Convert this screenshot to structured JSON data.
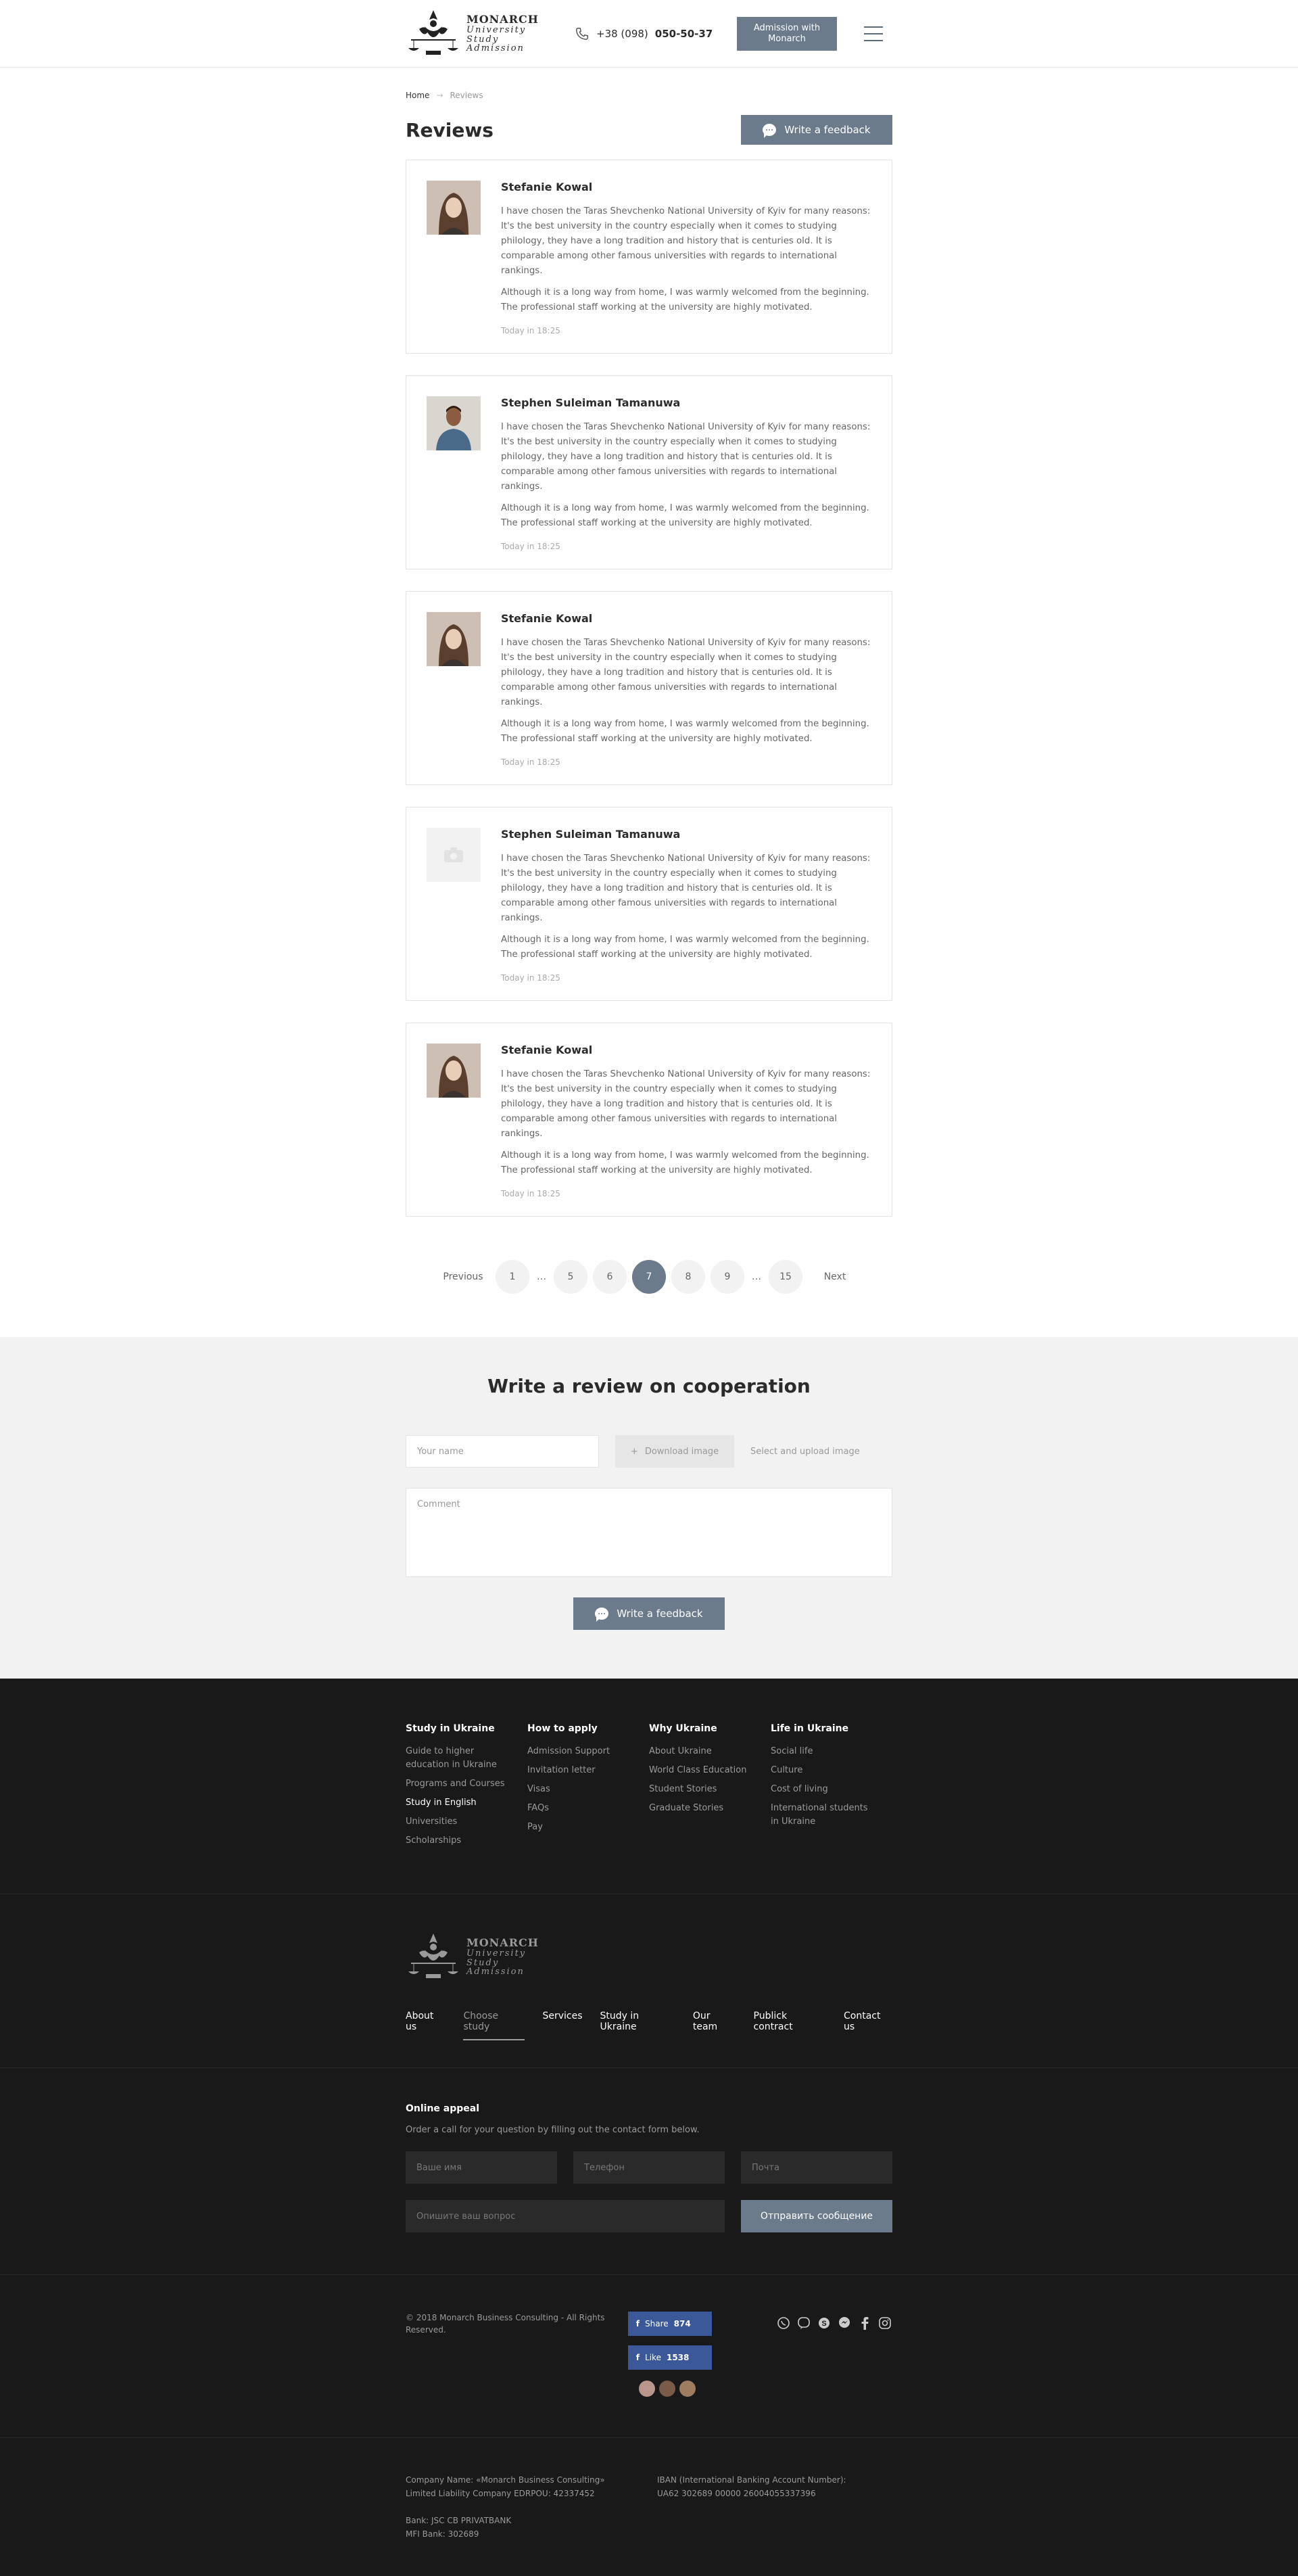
{
  "header": {
    "logo": {
      "line1": "MONARCH",
      "line2": "University",
      "line3": "Study",
      "line4": "Admission"
    },
    "phone_prefix": "+38 (098)",
    "phone_number": "050-50-37",
    "admission_button": "Admission with Monarch"
  },
  "breadcrumb": {
    "home": "Home",
    "separator": "→",
    "current": "Reviews"
  },
  "page": {
    "title": "Reviews",
    "write_feedback": "Write a feedback"
  },
  "reviews": [
    {
      "name": "Stefanie Kowal",
      "p1": "I have chosen the Taras Shevchenko National University of Kyiv for many reasons: It's the best university in the country especially when it comes to studying philology, they have a long tradition and history that is centuries old. It is comparable among other famous universities with regards to international rankings.",
      "p2": "Although it is a long way from home, I was warmly welcomed from the beginning. The professional staff working at the university are highly motivated.",
      "time": "Today in 18:25"
    },
    {
      "name": "Stephen Suleiman Tamanuwa",
      "p1": "I have chosen the Taras Shevchenko National University of Kyiv for many reasons: It's the best university in the country especially when it comes to studying philology, they have a long tradition and history that is centuries old. It is comparable among other famous universities with regards to international rankings.",
      "p2": "Although it is a long way from home, I was warmly welcomed from the beginning. The professional staff working at the university are highly motivated.",
      "time": "Today in 18:25"
    },
    {
      "name": "Stefanie Kowal",
      "p1": "I have chosen the Taras Shevchenko National University of Kyiv for many reasons: It's the best university in the country especially when it comes to studying philology, they have a long tradition and history that is centuries old. It is comparable among other famous universities with regards to international rankings.",
      "p2": "Although it is a long way from home, I was warmly welcomed from the beginning. The professional staff working at the university are highly motivated.",
      "time": "Today in 18:25"
    },
    {
      "name": "Stephen Suleiman Tamanuwa",
      "p1": "I have chosen the Taras Shevchenko National University of Kyiv for many reasons: It's the best university in the country especially when it comes to studying philology, they have a long tradition and history that is centuries old. It is comparable among other famous universities with regards to international rankings.",
      "p2": "Although it is a long way from home, I was warmly welcomed from the beginning. The professional staff working at the university are highly motivated.",
      "time": "Today in 18:25"
    },
    {
      "name": "Stefanie Kowal",
      "p1": "I have chosen the Taras Shevchenko National University of Kyiv for many reasons: It's the best university in the country especially when it comes to studying philology, they have a long tradition and history that is centuries old. It is comparable among other famous universities with regards to international rankings.",
      "p2": "Although it is a long way from home, I was warmly welcomed from the beginning. The professional staff working at the university are highly motivated.",
      "time": "Today in 18:25"
    }
  ],
  "pagination": {
    "previous": "Previous",
    "next": "Next",
    "pages": [
      "1",
      "…",
      "5",
      "6",
      "7",
      "8",
      "9",
      "…",
      "15"
    ],
    "current": "7"
  },
  "review_form": {
    "title": "Write a review on cooperation",
    "name_placeholder": "Your name",
    "download_label": "Download image",
    "upload_hint": "Select and upload image",
    "comment_placeholder": "Comment",
    "submit": "Write a feedback"
  },
  "footer": {
    "columns": [
      {
        "title": "Study in Ukraine",
        "links": [
          "Guide to higher education in Ukraine",
          "Programs and Courses",
          "Study in English",
          "Universities",
          "Scholarships"
        ]
      },
      {
        "title": "How to apply",
        "links": [
          "Admission Support",
          "Invitation letter",
          "Visas",
          "FAQs",
          "Pay"
        ]
      },
      {
        "title": "Why Ukraine",
        "links": [
          "About Ukraine",
          "World Class Education",
          "Student Stories",
          "Graduate Stories"
        ]
      },
      {
        "title": "Life in Ukraine",
        "links": [
          "Social life",
          "Culture",
          "Cost of living",
          "International students in Ukraine"
        ]
      }
    ],
    "nav": [
      "About us",
      "Choose study",
      "Services",
      "Study in Ukraine",
      "Our team",
      "Publick contract",
      "Contact us"
    ],
    "nav_selected": "Choose study",
    "appeal": {
      "title": "Online appeal",
      "text": "Order a call for your question by filling out the contact form below.",
      "name_placeholder": "Ваше имя",
      "phone_placeholder": "Телефон",
      "email_placeholder": "Почта",
      "question_placeholder": "Опишите ваш вопрос",
      "submit": "Отправить сообщение"
    },
    "copyright": "© 2018 Monarch Business Consulting - All Rights Reserved.",
    "share": {
      "label": "Share",
      "count": "874"
    },
    "like": {
      "label": "Like",
      "count": "1538"
    },
    "social_icons": [
      "whatsapp-icon",
      "viber-icon",
      "skype-icon",
      "messenger-icon",
      "facebook-icon",
      "instagram-icon"
    ],
    "company": {
      "name_line1": "Company Name: «Monarch Business Consulting»",
      "name_line2": "Limited Liability Company EDRPOU: 42337452",
      "bank_line1": "Bank: JSC CB PRIVATBANK",
      "bank_line2": "MFI Bank: 302689",
      "iban_line1": "IBAN (International Banking Account Number):",
      "iban_line2": "UA62 302689 00000 26004055337396"
    }
  },
  "colors": {
    "accent": "#6b7b8c",
    "footer_bg": "#191919",
    "form_bg": "#f2f2f2",
    "facebook": "#3b5998"
  }
}
